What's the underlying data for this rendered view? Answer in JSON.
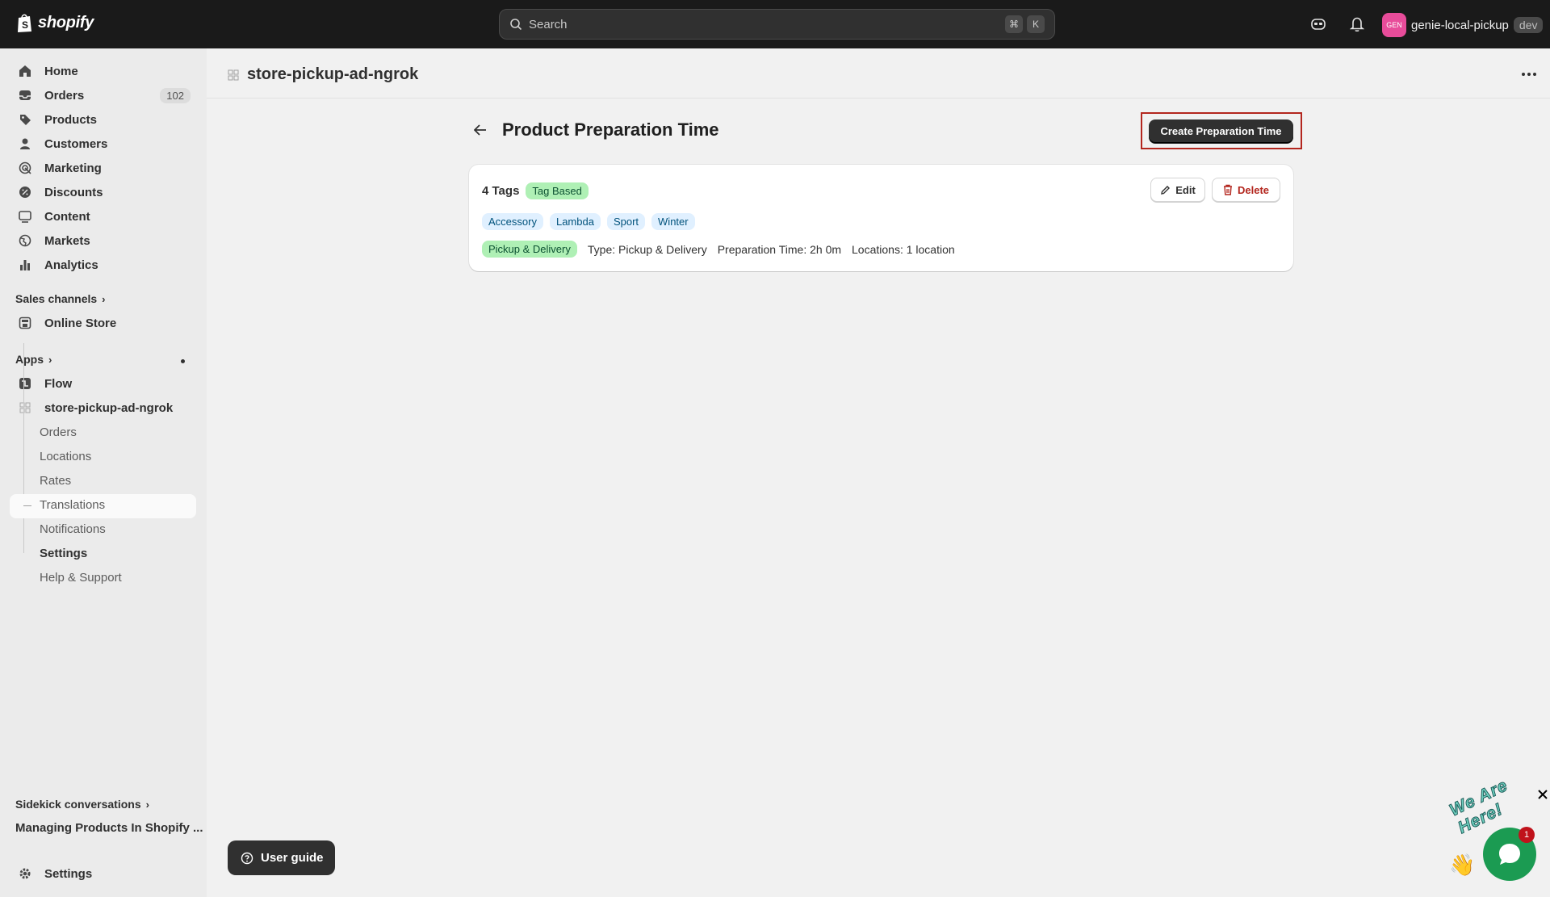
{
  "topbar": {
    "brand": "shopify",
    "search_placeholder": "Search",
    "shortcut_key1": "⌘",
    "shortcut_key2": "K",
    "avatar_initials": "GEN",
    "store_name": "genie-local-pickup",
    "env_badge": "dev"
  },
  "sidebar": {
    "items": [
      {
        "label": "Home"
      },
      {
        "label": "Orders",
        "count": "102"
      },
      {
        "label": "Products"
      },
      {
        "label": "Customers"
      },
      {
        "label": "Marketing"
      },
      {
        "label": "Discounts"
      },
      {
        "label": "Content"
      },
      {
        "label": "Markets"
      },
      {
        "label": "Analytics"
      }
    ],
    "sales_channels_label": "Sales channels",
    "online_store_label": "Online Store",
    "apps_label": "Apps",
    "flow_label": "Flow",
    "app_name": "store-pickup-ad-ngrok",
    "app_subitems": [
      "Orders",
      "Locations",
      "Rates",
      "Translations",
      "Notifications",
      "Settings",
      "Help & Support"
    ],
    "sidekick_label": "Sidekick conversations",
    "sidekick_item": "Managing Products In Shopify ...",
    "settings_label": "Settings"
  },
  "header": {
    "app_title": "store-pickup-ad-ngrok"
  },
  "main": {
    "page_title": "Product Preparation Time",
    "create_button": "Create Preparation Time",
    "card": {
      "tag_count": "4 Tags",
      "mode_badge": "Tag Based",
      "edit_label": "Edit",
      "delete_label": "Delete",
      "tags": [
        "Accessory",
        "Lambda",
        "Sport",
        "Winter"
      ],
      "fulfillment_badge": "Pickup & Delivery",
      "type_text": "Type: Pickup & Delivery",
      "prep_time_text": "Preparation Time: 2h 0m",
      "locations_text": "Locations: 1 location"
    }
  },
  "user_guide_label": "User guide",
  "chat": {
    "label": "We Are Here!",
    "unread_count": "1"
  },
  "colors": {
    "topbar_bg": "#1a1a1a",
    "highlight_border": "#b3261e",
    "green_badge": "#aff0b5",
    "blue_badge": "#e0f0ff",
    "chat_green": "#1b9b52"
  }
}
